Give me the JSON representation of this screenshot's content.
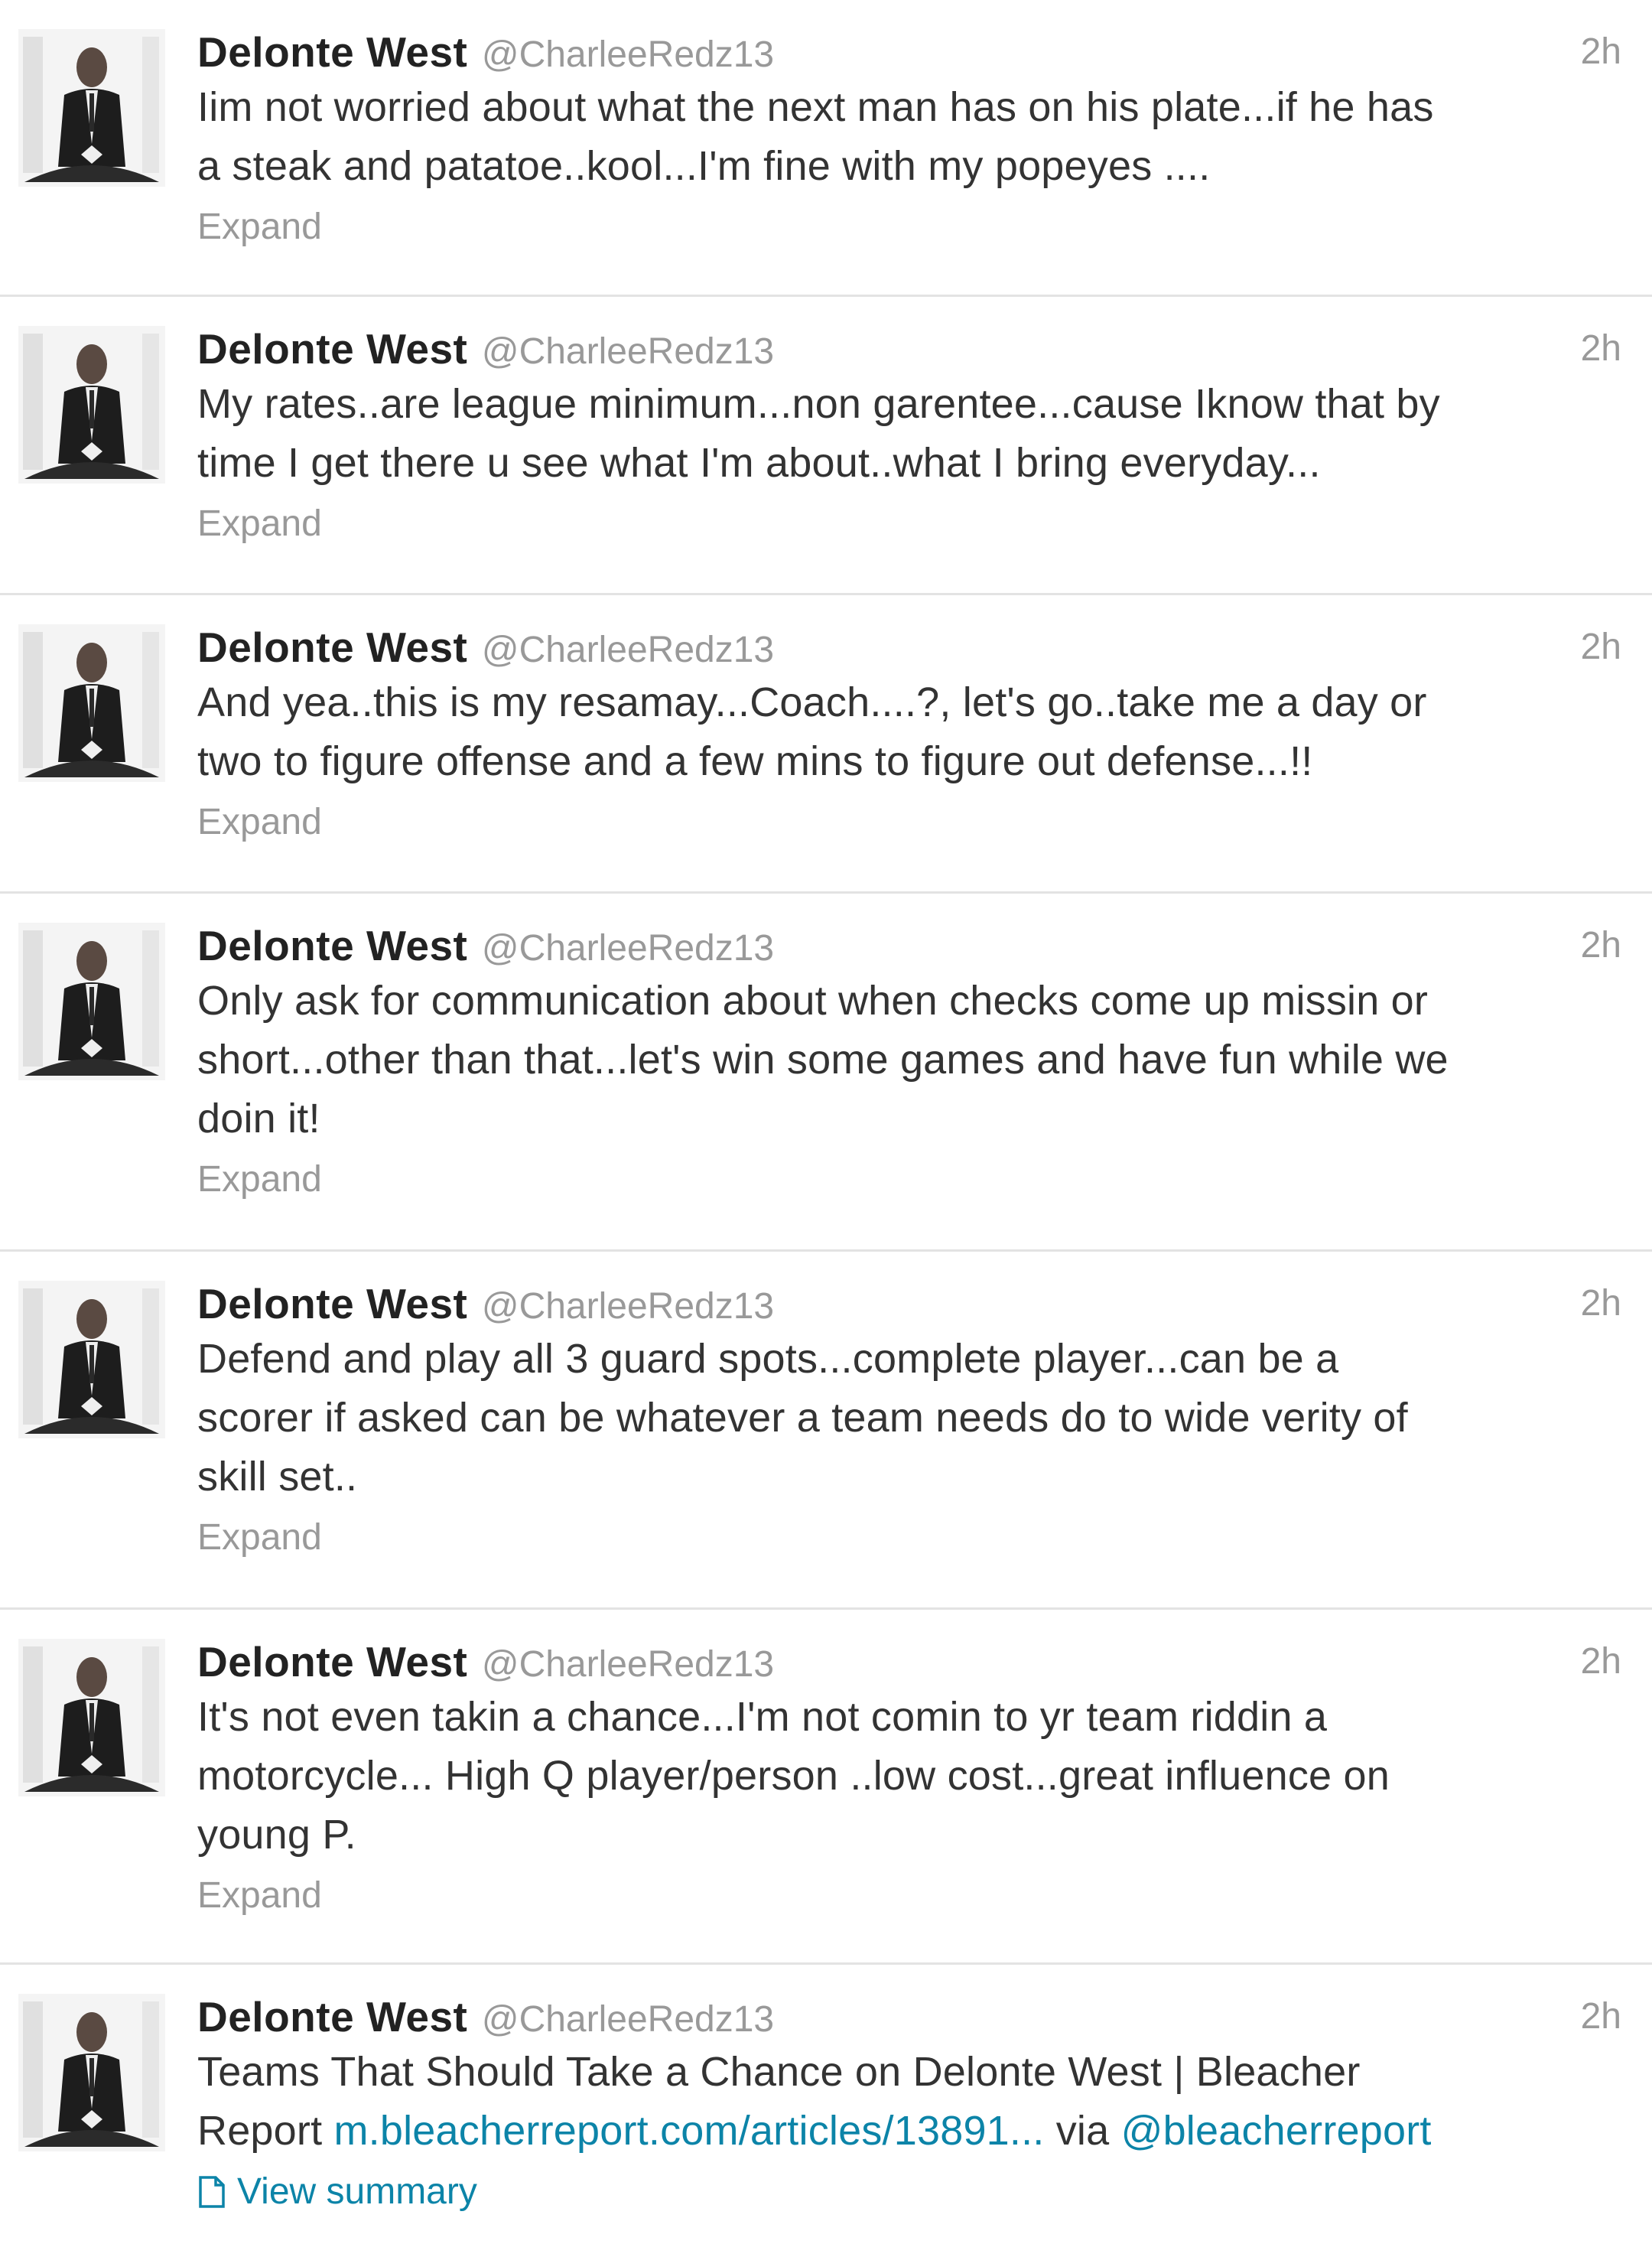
{
  "tweets": [
    {
      "fullname": "Delonte West",
      "handle": "@CharleeRedz13",
      "time": "2h",
      "lines": [
        "Iim not worried about what the next man has on his plate...if he has",
        "a steak and patatoe..kool...I'm fine with my popeyes ...."
      ],
      "action": "Expand"
    },
    {
      "fullname": "Delonte West",
      "handle": "@CharleeRedz13",
      "time": "2h",
      "lines": [
        "My rates..are league minimum...non garentee...cause Iknow that by",
        "time I get there u see what I'm about..what I bring everyday..."
      ],
      "action": "Expand"
    },
    {
      "fullname": "Delonte West",
      "handle": "@CharleeRedz13",
      "time": "2h",
      "lines": [
        "And yea..this is my resamay...Coach....?, let's go..take me a day or",
        "two to figure offense and a few mins to figure out defense...!!"
      ],
      "action": "Expand"
    },
    {
      "fullname": "Delonte West",
      "handle": "@CharleeRedz13",
      "time": "2h",
      "lines": [
        "Only ask for communication about when checks come up missin or",
        "short...other than that...let's win some games and have fun while we",
        "doin it!"
      ],
      "action": "Expand"
    },
    {
      "fullname": "Delonte West",
      "handle": "@CharleeRedz13",
      "time": "2h",
      "lines": [
        "Defend and play all 3 guard spots...complete player...can be a",
        "scorer if asked can be whatever a team needs do to wide verity of",
        "skill set.."
      ],
      "action": "Expand"
    },
    {
      "fullname": "Delonte West",
      "handle": "@CharleeRedz13",
      "time": "2h",
      "lines": [
        "It's not even takin a chance...I'm not comin to yr team riddin a",
        "motorcycle... High Q player/person ..low cost...great influence on",
        "young P."
      ],
      "action": "Expand"
    },
    {
      "fullname": "Delonte West",
      "handle": "@CharleeRedz13",
      "time": "2h",
      "line1": "Teams That Should Take a Chance on Delonte West | Bleacher",
      "line2_prefix": "Report ",
      "link_url": "m.bleacherreport.com/articles/13891...",
      "line2_mid": " via ",
      "link_mention": "@bleacherreport",
      "action": "View summary"
    }
  ],
  "colors": {
    "link": "#0c84a8",
    "meta": "#999999",
    "text": "#333333"
  }
}
